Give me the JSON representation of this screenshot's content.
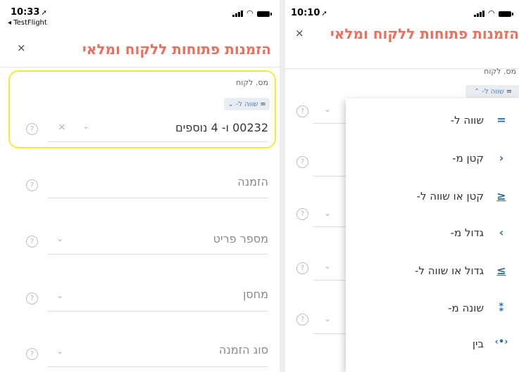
{
  "screen1": {
    "status": {
      "time": "10:33",
      "back_app": "◂ TestFlight"
    },
    "header": {
      "close": "×",
      "title": "הזמנות פתוחות ללקוח ומלאי"
    },
    "customer_field": {
      "label": "מס. לקוח",
      "operator": "שווה ל-",
      "operator_symbol": "=",
      "operator_chevron": "⌄",
      "value": "00232 ו- 4 נוספים"
    },
    "fields": [
      {
        "label": "הזמנה"
      },
      {
        "label": "מספר פריט"
      },
      {
        "label": "מחסן"
      },
      {
        "label": "סוג הזמנה"
      }
    ],
    "help_symbol": "?",
    "chevron": "⌄",
    "clear": "×"
  },
  "screen2": {
    "status": {
      "time": "10:10"
    },
    "header": {
      "close": "×",
      "title": "הזמנות פתוחות ללקוח ומלאי"
    },
    "customer_field": {
      "label": "מס. לקוח",
      "operator": "שווה ל-",
      "operator_symbol": "=",
      "operator_chevron": "⌃"
    },
    "operator_menu": {
      "items": [
        {
          "label": "שווה ל-",
          "icon": "equals-icon",
          "glyph": "="
        },
        {
          "label": "קטן מ-",
          "icon": "less-than-icon",
          "glyph": "›"
        },
        {
          "label": "קטן או שווה ל-",
          "icon": "less-equal-icon",
          "glyph": "≥"
        },
        {
          "label": "גדול מ-",
          "icon": "greater-than-icon",
          "glyph": "‹"
        },
        {
          "label": "גדול או שווה ל-",
          "icon": "greater-equal-icon",
          "glyph": "≤"
        },
        {
          "label": "שונה מ-",
          "icon": "not-equal-icon",
          "glyph": "⁑"
        },
        {
          "label": "בין",
          "icon": "between-icon",
          "glyph": "‹•›"
        }
      ]
    }
  },
  "colors": {
    "accent": "#e8705f",
    "highlight": "#f4ec3c",
    "link": "#4a86c5",
    "menu_icon": "#2f6fa7"
  }
}
